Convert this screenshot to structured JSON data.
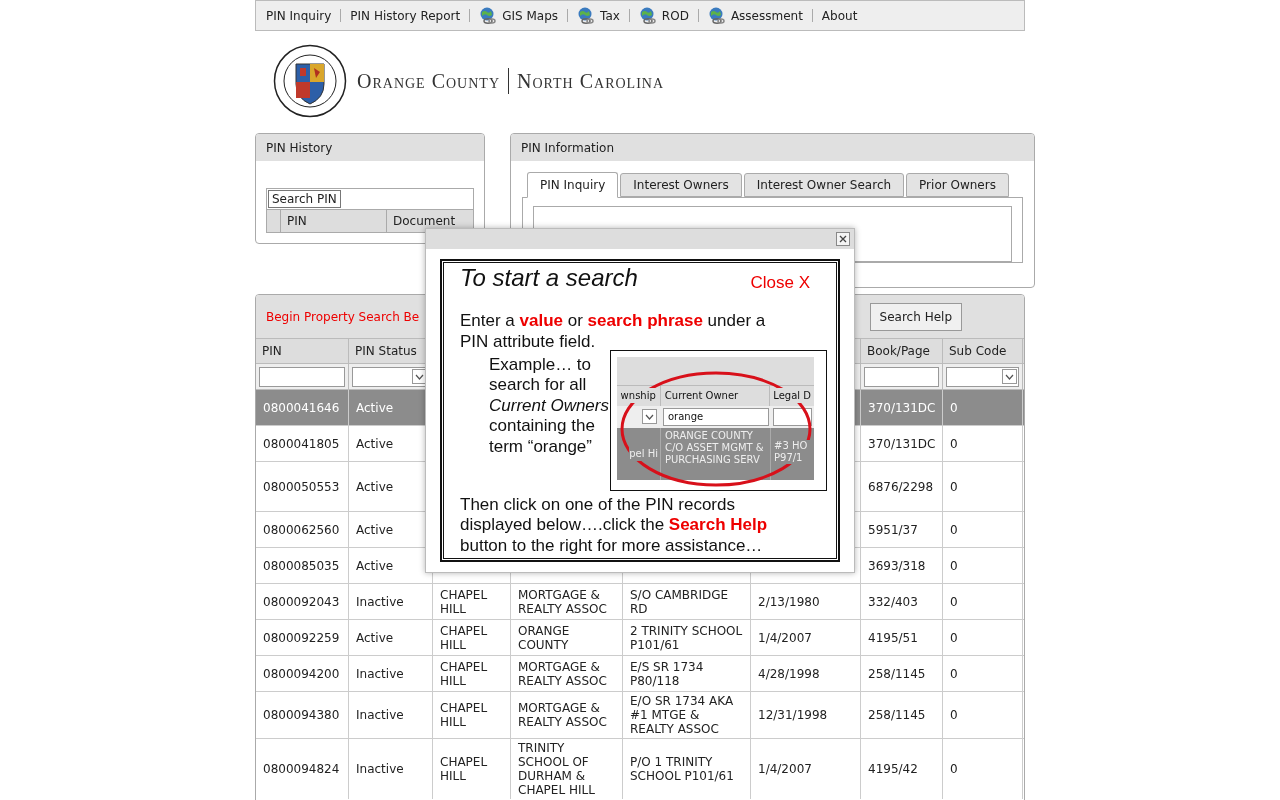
{
  "nav": [
    {
      "label": "PIN Inquiry",
      "kind": "plain"
    },
    {
      "label": "PIN History Report",
      "kind": "plain"
    },
    {
      "label": "GIS Maps",
      "kind": "globe"
    },
    {
      "label": "Tax",
      "kind": "globe"
    },
    {
      "label": "ROD",
      "kind": "globe"
    },
    {
      "label": "Assessment",
      "kind": "globe"
    },
    {
      "label": "About",
      "kind": "plain"
    }
  ],
  "header": {
    "county": "Orange County",
    "state": "North Carolina"
  },
  "pin_history": {
    "title": "PIN History",
    "search_button": "Search PIN",
    "columns": [
      "PIN",
      "Document"
    ]
  },
  "pin_information": {
    "title": "PIN Information",
    "tabs": [
      {
        "label": "PIN Inquiry",
        "selected": true
      },
      {
        "label": "Interest Owners",
        "selected": false
      },
      {
        "label": "Interest Owner Search",
        "selected": false
      },
      {
        "label": "Prior Owners",
        "selected": false
      }
    ]
  },
  "search_panel": {
    "title": "Begin Property Search Be",
    "help_button": "Search Help",
    "columns": [
      {
        "label": "PIN",
        "kind": "text"
      },
      {
        "label": "PIN Status",
        "kind": "select"
      },
      {
        "kind": "blank"
      },
      {
        "kind": "blank"
      },
      {
        "kind": "blank"
      },
      {
        "kind": "blank"
      },
      {
        "label": "Book/Page",
        "kind": "text"
      },
      {
        "label": "Sub Code",
        "kind": "select"
      }
    ],
    "rows": [
      {
        "selected": true,
        "cells": [
          "0800041646",
          "Active",
          null,
          null,
          null,
          null,
          "370/131DC",
          "0"
        ]
      },
      {
        "selected": false,
        "cells": [
          "0800041805",
          "Active",
          null,
          null,
          null,
          null,
          "370/131DC",
          "0"
        ]
      },
      {
        "selected": false,
        "cells": [
          "0800050553",
          "Active",
          null,
          null,
          null,
          null,
          "6876/2298",
          "0"
        ]
      },
      {
        "selected": false,
        "cells": [
          "0800062560",
          "Active",
          null,
          null,
          null,
          null,
          "5951/37",
          "0"
        ]
      },
      {
        "selected": false,
        "cells": [
          "0800085035",
          "Active",
          null,
          null,
          null,
          null,
          "3693/318",
          "0"
        ]
      },
      {
        "selected": false,
        "cells": [
          "0800092043",
          "Inactive",
          "CHAPEL HILL",
          "MORTGAGE & REALTY ASSOC",
          "S/O CAMBRIDGE RD",
          "2/13/1980",
          "332/403",
          "0"
        ]
      },
      {
        "selected": false,
        "cells": [
          "0800092259",
          "Active",
          "CHAPEL HILL",
          "ORANGE COUNTY",
          "2 TRINITY SCHOOL P101/61",
          "1/4/2007",
          "4195/51",
          "0"
        ]
      },
      {
        "selected": false,
        "cells": [
          "0800094200",
          "Inactive",
          "CHAPEL HILL",
          "MORTGAGE & REALTY ASSOC",
          "E/S SR 1734 P80/118",
          "4/28/1998",
          "258/1145",
          "0"
        ]
      },
      {
        "selected": false,
        "cells": [
          "0800094380",
          "Inactive",
          "CHAPEL HILL",
          "MORTGAGE & REALTY ASSOC",
          "E/O SR 1734 AKA #1 MTGE & REALTY ASSOC",
          "12/31/1998",
          "258/1145",
          "0"
        ]
      },
      {
        "selected": false,
        "cells": [
          "0800094824",
          "Inactive",
          "CHAPEL HILL",
          "TRINITY SCHOOL OF DURHAM & CHAPEL HILL",
          "P/O 1 TRINITY SCHOOL P101/61",
          "1/4/2007",
          "4195/42",
          "0"
        ]
      }
    ]
  },
  "help_dialog": {
    "title": "To start a search",
    "close_link": "Close X",
    "intro": "Enter a **value** or **search phrase** under a PIN attribute field.",
    "example": "Example… to search for all *Current Owners* containing the term “orange”",
    "outro": "Then click on one of the PIN records displayed below….click the **Search Help** button to the right for more assistance…",
    "example_image": {
      "columns": [
        "wnship",
        "Current Owner",
        "Legal D"
      ],
      "filter_value": "orange",
      "row": [
        "pel Hi",
        "ORANGE COUNTY C/O ASSET MGMT & PURCHASING SERV",
        "#3 HO P97/1"
      ]
    }
  }
}
